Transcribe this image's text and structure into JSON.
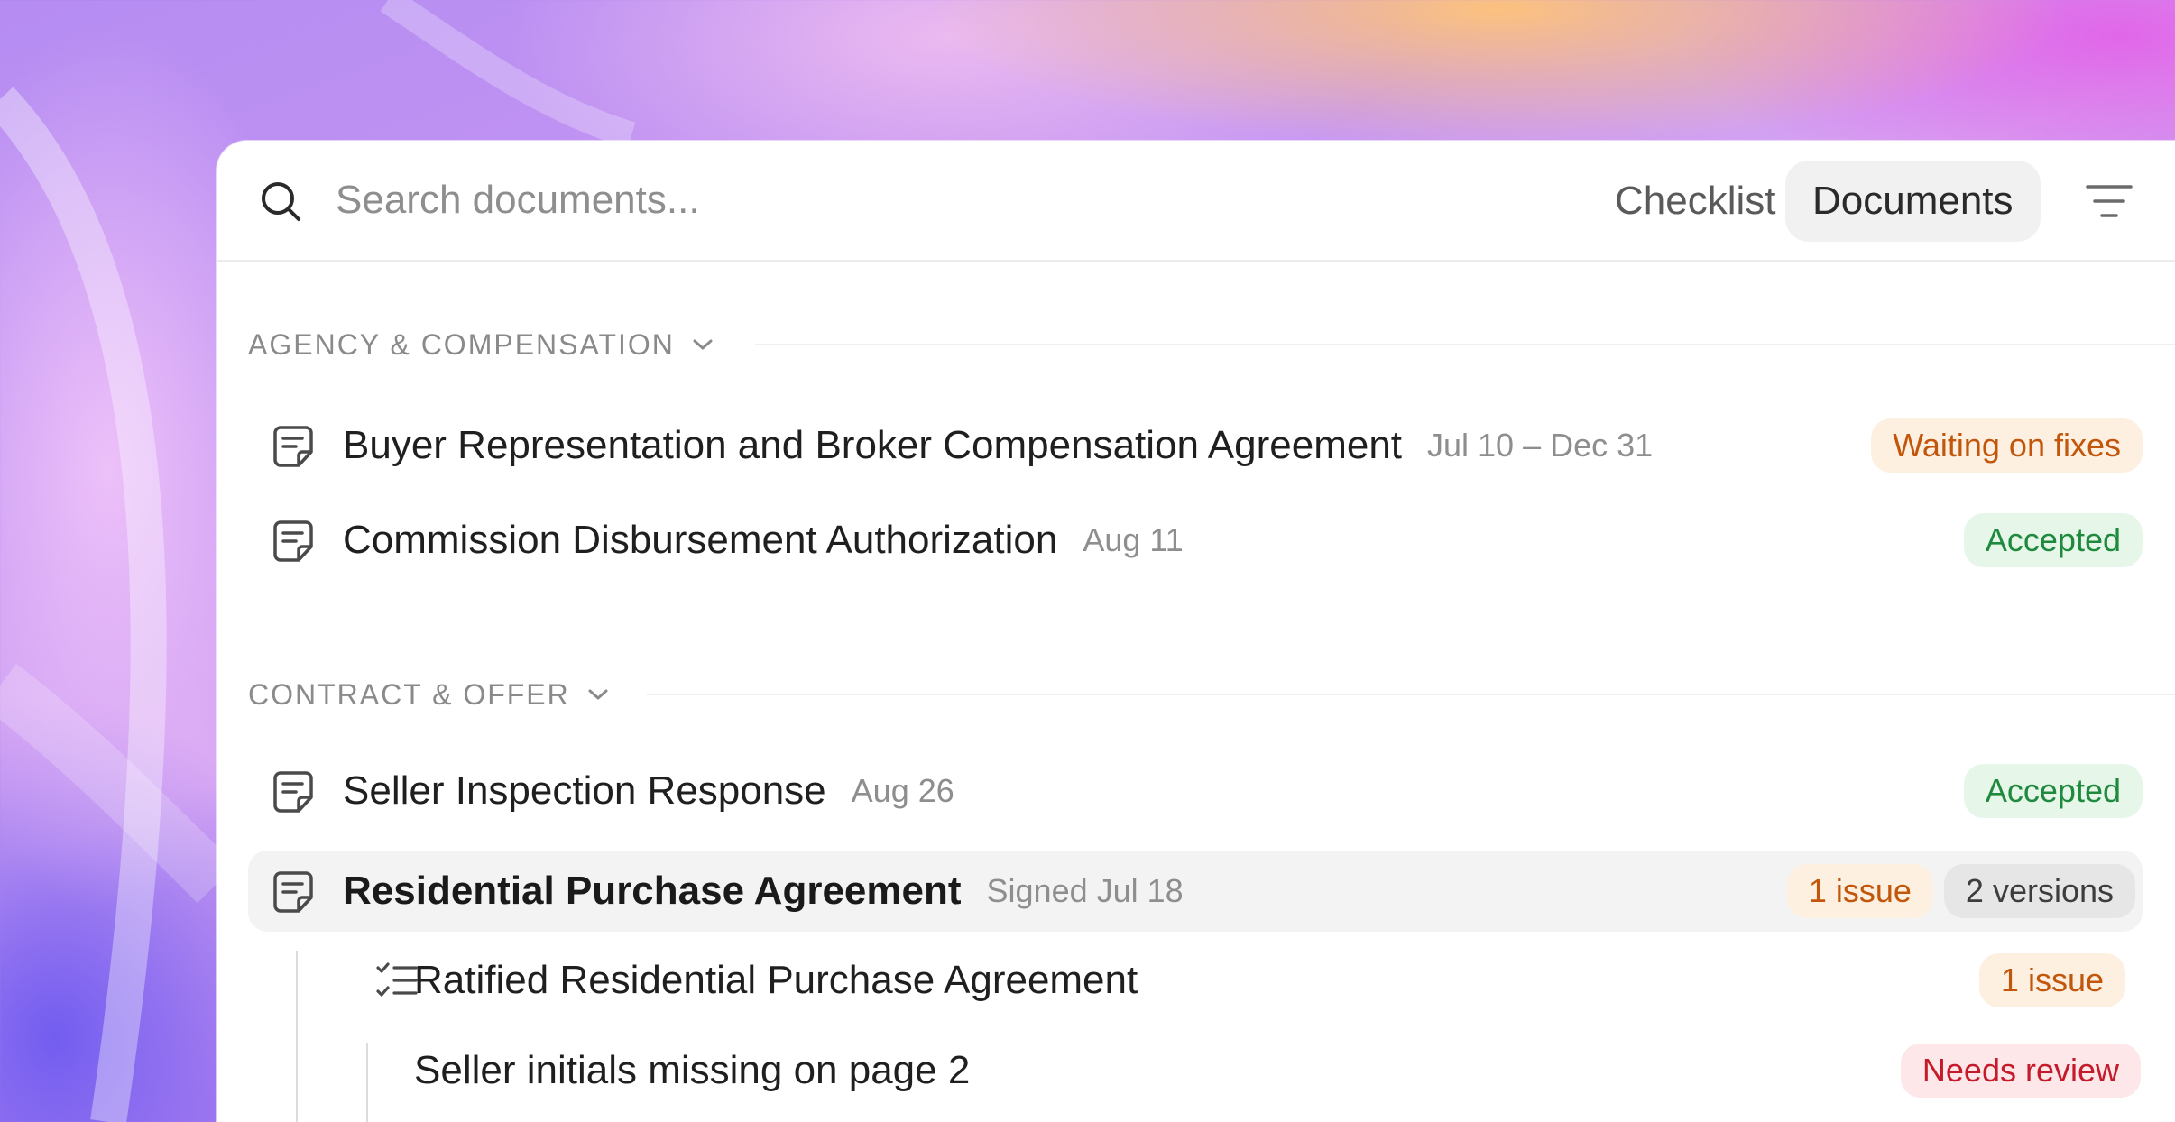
{
  "search": {
    "placeholder": "Search documents..."
  },
  "tabs": {
    "checklist": "Checklist",
    "documents": "Documents",
    "active": "documents"
  },
  "sections": [
    {
      "title": "AGENCY & COMPENSATION",
      "rows": [
        {
          "title": "Buyer Representation and Broker Compensation Agreement",
          "meta": "Jul 10 – Dec 31",
          "badges": [
            {
              "label": "Waiting on fixes",
              "tone": "orange"
            }
          ]
        },
        {
          "title": "Commission Disbursement Authorization",
          "meta": "Aug 11",
          "badges": [
            {
              "label": "Accepted",
              "tone": "green"
            }
          ]
        }
      ]
    },
    {
      "title": "CONTRACT & OFFER",
      "rows": [
        {
          "title": "Seller Inspection Response",
          "meta": "Aug 26",
          "badges": [
            {
              "label": "Accepted",
              "tone": "green"
            }
          ]
        },
        {
          "title": "Residential Purchase Agreement",
          "meta": "Signed Jul 18",
          "badges": [
            {
              "label": "1 issue",
              "tone": "orange"
            },
            {
              "label": "2 versions",
              "tone": "gray"
            }
          ],
          "children": [
            {
              "title": "Ratified Residential Purchase Agreement",
              "badges": [
                {
                  "label": "1 issue",
                  "tone": "orange"
                }
              ],
              "children": [
                {
                  "title": "Seller initials missing on page 2",
                  "badges": [
                    {
                      "label": "Needs review",
                      "tone": "red"
                    }
                  ]
                }
              ]
            }
          ]
        }
      ]
    }
  ],
  "colors": {
    "orange_badge_text": "#c2560b",
    "green_badge_text": "#1f8a3e",
    "red_badge_text": "#c41a2a",
    "gray_badge_text": "#3d3d3d"
  },
  "icons": {
    "search": "search-icon",
    "filter": "filter-icon",
    "document": "document-icon",
    "checklist": "checklist-icon",
    "chevron": "chevron-down-icon"
  }
}
